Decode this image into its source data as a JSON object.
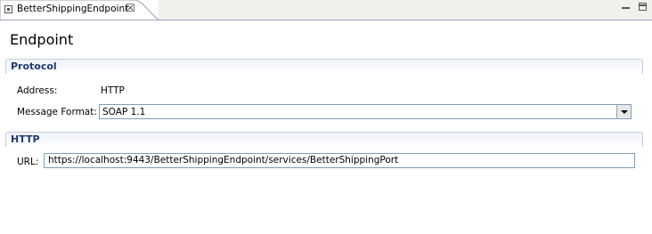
{
  "tab": {
    "title": "BetterShippingEndpoint",
    "close_icon": "close-icon"
  },
  "window_controls": {
    "minimize_icon": "minimize-icon",
    "maximize_icon": "maximize-icon"
  },
  "page": {
    "title": "Endpoint"
  },
  "protocol_section": {
    "title": "Protocol",
    "address_label": "Address:",
    "address_value": "HTTP",
    "message_format_label": "Message Format:",
    "message_format_value": "SOAP 1.1"
  },
  "http_section": {
    "title": "HTTP",
    "url_label": "URL:",
    "url_value": "https://localhost:9443/BetterShippingEndpoint/services/BetterShippingPort"
  },
  "colors": {
    "section_title": "#1f3a6e",
    "input_border": "#7f9db9",
    "tabbar_bg": "#f0f0ec"
  }
}
